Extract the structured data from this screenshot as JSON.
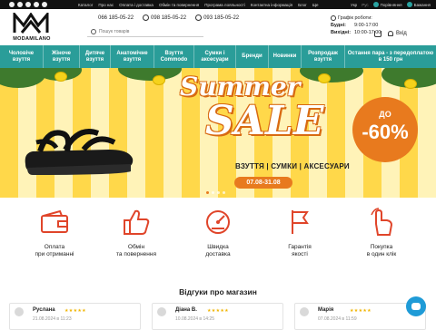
{
  "topbar": {
    "links": [
      "Каталог",
      "Про нас",
      "Оплата і доставка",
      "Обмін та повернення",
      "Програма лояльності",
      "Контактна інформація",
      "Блог",
      "Ще"
    ],
    "language": "Укр",
    "language_alt": "Рус",
    "favorites_label": "Порівняння",
    "wishlist_label": "Бажання"
  },
  "header": {
    "logo_text": "MODAMILANO",
    "phones": [
      "066 185-05-22",
      "098 185-05-22",
      "093 185-05-22"
    ],
    "search_placeholder": "Пошук товарів",
    "schedule": {
      "title": "Графік роботи:",
      "weekdays_label": "Будні:",
      "weekdays_hours": "9:00-17:00",
      "weekend_label": "Вихідні:",
      "weekend_hours": "10:00-17:00"
    },
    "login_label": "Вхід"
  },
  "nav": {
    "items": [
      "Чоловіче взуття",
      "Жіноче взуття",
      "Дитяче взуття",
      "Анатомічне взуття",
      "Взуття Commodo",
      "Сумки і аксесуари",
      "Бренди",
      "Новинки",
      "Розпродаж взуття",
      "Остання пара - з передоплатою в 150 грн"
    ]
  },
  "banner": {
    "title_line1": "Summer",
    "title_line2": "SALE",
    "subtitle": "ВЗУТТЯ | СУМКИ | АКСЕСУАРИ",
    "dates": "07.08-31.08",
    "discount_prefix": "ДО",
    "discount": "-60%",
    "colors": {
      "accent": "#e87a1e",
      "stripe": "#ffd84a"
    }
  },
  "features": [
    {
      "icon": "wallet-icon",
      "label_line1": "Оплата",
      "label_line2": "при отриманні"
    },
    {
      "icon": "thumbs-up-icon",
      "label_line1": "Обмін",
      "label_line2": "та повернення"
    },
    {
      "icon": "speedometer-icon",
      "label_line1": "Швидка",
      "label_line2": "доставка"
    },
    {
      "icon": "flag-icon",
      "label_line1": "Гарантія",
      "label_line2": "якості"
    },
    {
      "icon": "pointer-hand-icon",
      "label_line1": "Покупка",
      "label_line2": "в один клік"
    }
  ],
  "reviews": {
    "title": "Відгуки про магазин",
    "items": [
      {
        "name": "Руслана",
        "stars": "★★★★★",
        "date": "21.08.2024 в 11:23"
      },
      {
        "name": "Діана В.",
        "stars": "★★★★★",
        "date": "10.08.2024 в 14:25"
      },
      {
        "name": "Марія",
        "stars": "★★★★★",
        "date": "07.08.2024 в 11:59"
      }
    ]
  },
  "theme": {
    "nav_color": "#2a9d99",
    "chat_color": "#1f9bd7"
  }
}
